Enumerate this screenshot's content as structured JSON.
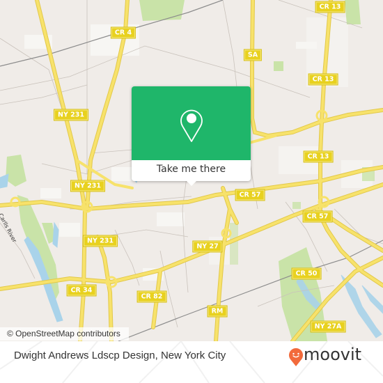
{
  "map": {
    "road_labels": [
      {
        "id": "cr4",
        "text": "CR 4"
      },
      {
        "id": "cr13-top",
        "text": "CR 13"
      },
      {
        "id": "sa",
        "text": "SA"
      },
      {
        "id": "cr13-mid",
        "text": "CR 13"
      },
      {
        "id": "ny231-top",
        "text": "NY 231"
      },
      {
        "id": "cr13-lower",
        "text": "CR 13"
      },
      {
        "id": "ny231-mid",
        "text": "NY 231"
      },
      {
        "id": "cr57-left",
        "text": "CR 57"
      },
      {
        "id": "cr57-right",
        "text": "CR 57"
      },
      {
        "id": "ny231-low",
        "text": "NY 231"
      },
      {
        "id": "ny27",
        "text": "NY 27"
      },
      {
        "id": "cr50",
        "text": "CR 50"
      },
      {
        "id": "cr34",
        "text": "CR 34"
      },
      {
        "id": "cr82",
        "text": "CR 82"
      },
      {
        "id": "rm",
        "text": "RM"
      },
      {
        "id": "ny27a",
        "text": "NY 27A"
      }
    ],
    "water_labels": [
      {
        "text": "Carlls River"
      }
    ],
    "attribution": "© OpenStreetMap contributors",
    "colors": {
      "road": "#f7e26b",
      "road_casing": "#e2c84a",
      "land": "#f0ece8",
      "park": "#c9e3a8",
      "water": "#a9d3ea"
    }
  },
  "popup": {
    "icon": "map-pin-icon",
    "button_label": "Take me there",
    "color": "#1fb66a"
  },
  "footer": {
    "place_name": "Dwight Andrews Ldscp Design, New York City",
    "brand": "moovit",
    "brand_color": "#f26a3b"
  }
}
